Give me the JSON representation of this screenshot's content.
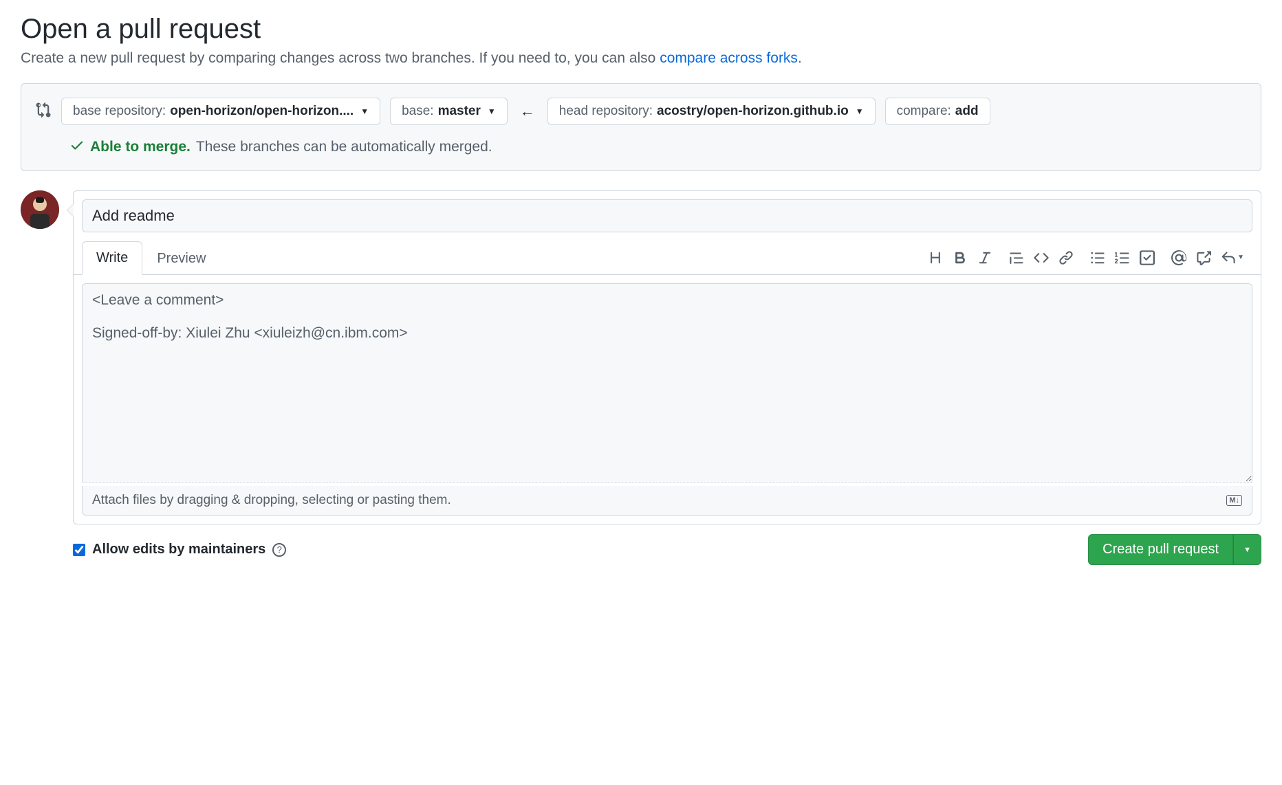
{
  "header": {
    "title": "Open a pull request",
    "subtitle_prefix": "Create a new pull request by comparing changes across two branches. If you need to, you can also ",
    "subtitle_link": "compare across forks",
    "subtitle_suffix": "."
  },
  "compare": {
    "base_repo_label": "base repository: ",
    "base_repo_value": "open-horizon/open-horizon....",
    "base_branch_label": "base: ",
    "base_branch_value": "master",
    "head_repo_label": "head repository: ",
    "head_repo_value": "acostry/open-horizon.github.io",
    "compare_label": "compare: ",
    "compare_value": "add"
  },
  "merge": {
    "able": "Able to merge.",
    "rest": "These branches can be automatically merged."
  },
  "pr": {
    "title_value": "Add readme",
    "tabs": {
      "write": "Write",
      "preview": "Preview"
    },
    "comment_value": "<Leave a comment>\n\nSigned-off-by: Xiulei Zhu <xiuleizh@cn.ibm.com>",
    "attach_hint": "Attach files by dragging & dropping, selecting or pasting them.",
    "md_badge": "M↓"
  },
  "footer": {
    "allow_edits": "Allow edits by maintainers",
    "create_btn": "Create pull request"
  }
}
